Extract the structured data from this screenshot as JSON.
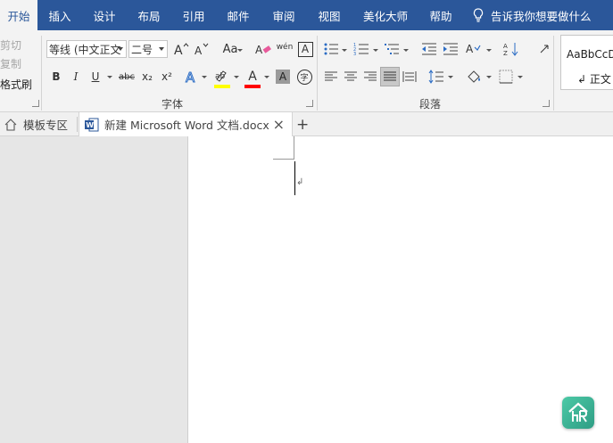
{
  "ribbon_tabs": [
    "开始",
    "插入",
    "设计",
    "布局",
    "引用",
    "邮件",
    "审阅",
    "视图",
    "美化大师",
    "帮助"
  ],
  "tell_me": "告诉我你想要做什么",
  "clipboard": {
    "cut": "剪切",
    "copy": "复制",
    "format_painter": "格式刷"
  },
  "font_group": {
    "label": "字体",
    "font_name": "等线 (中文正文",
    "font_size": "二号",
    "bold": "B",
    "italic": "I",
    "underline": "U",
    "strikethrough": "abc",
    "subscript": "x₂",
    "superscript": "x²",
    "change_case": "Aa",
    "phonetic": "wén",
    "border_char": "A",
    "highlight_letter": "A",
    "enclose_char": "字"
  },
  "paragraph_group": {
    "label": "段落"
  },
  "styles": {
    "sample": "AaBbCcD",
    "name": "↲ 正文"
  },
  "doc_tabs": {
    "template_zone": "模板专区",
    "document": "新建 Microsoft Word 文档.docx",
    "close": "×",
    "new": "+"
  },
  "document": {
    "paragraph_mark": "↲"
  },
  "colors": {
    "accent": "#2b579a",
    "highlight": "#ffff00",
    "font_color": "#ff0000"
  }
}
